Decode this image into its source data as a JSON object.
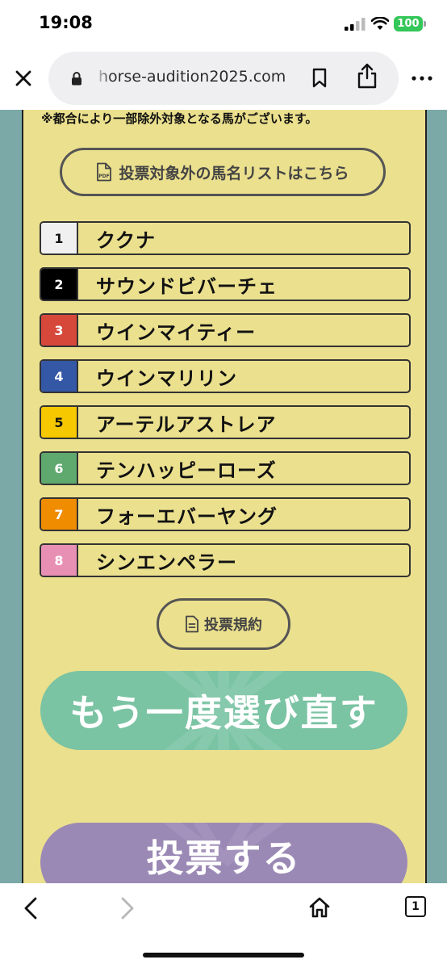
{
  "status_bar": {
    "time": "19:08",
    "battery": "100"
  },
  "browser": {
    "url": "horse-audition2025.com"
  },
  "content": {
    "notice": "※都合により一部除外対象となる馬がございます。",
    "pdf_button_label": "投票対象外の馬名リストはこちら",
    "pdf_icon_text": "PDF",
    "horses": [
      {
        "number": "1",
        "name": "ククナ",
        "color": "#f0f0f0",
        "text_color": "#111111"
      },
      {
        "number": "2",
        "name": "サウンドビバーチェ",
        "color": "#000000",
        "text_color": "#ffffff"
      },
      {
        "number": "3",
        "name": "ウインマイティー",
        "color": "#d6483a",
        "text_color": "#ffffff"
      },
      {
        "number": "4",
        "name": "ウインマリリン",
        "color": "#3457a6",
        "text_color": "#ffffff"
      },
      {
        "number": "5",
        "name": "アーテルアストレア",
        "color": "#f5c800",
        "text_color": "#111111"
      },
      {
        "number": "6",
        "name": "テンハッピーローズ",
        "color": "#5fa86e",
        "text_color": "#ffffff"
      },
      {
        "number": "7",
        "name": "フォーエバーヤング",
        "color": "#f08c00",
        "text_color": "#ffffff"
      },
      {
        "number": "8",
        "name": "シンエンペラー",
        "color": "#e890b4",
        "text_color": "#ffffff"
      }
    ],
    "rules_button_label": "投票規約",
    "redo_button_label": "もう一度選び直す",
    "vote_button_label": "投票する"
  },
  "toolbar": {
    "tab_count": "1"
  },
  "colors": {
    "page_bg": "#7aa9a8",
    "card_bg": "#ebe08e",
    "redo_bg": "#7ac3a3",
    "vote_bg": "#9b89b5"
  },
  "icons": [
    "close-icon",
    "lock-icon",
    "bookmark-icon",
    "share-icon",
    "more-icon",
    "pdf-icon",
    "document-icon",
    "back-icon",
    "forward-icon",
    "home-icon",
    "tabs-icon"
  ]
}
